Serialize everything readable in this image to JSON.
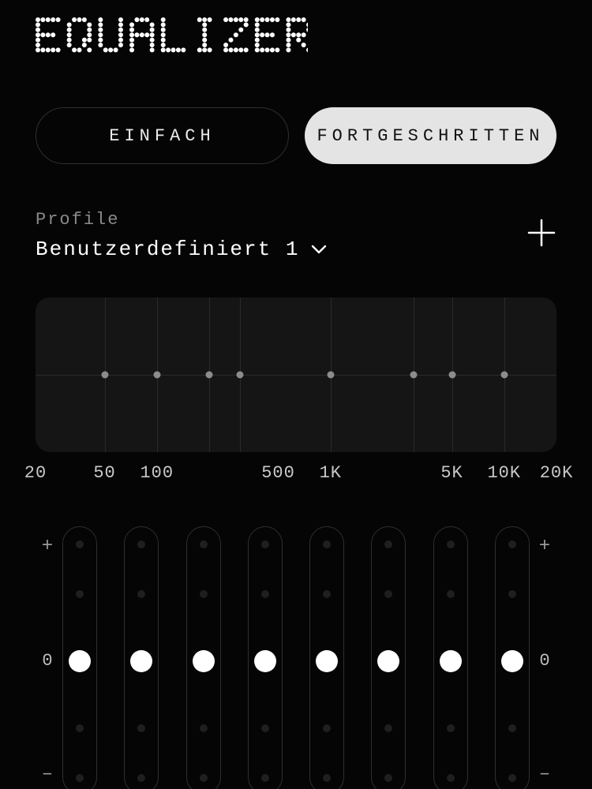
{
  "title": "EQUALIZER",
  "tabs": {
    "simple": "EINFACH",
    "advanced": "FORTGESCHRITTEN",
    "active": "advanced"
  },
  "profile": {
    "label": "Profile",
    "selected": "Benutzerdefiniert 1"
  },
  "side": {
    "plus": "+",
    "zero": "0",
    "minus": "–"
  },
  "chart_data": {
    "type": "line",
    "title": "",
    "xlabel": "",
    "ylabel": "",
    "x_axis_scale": "log",
    "xlim": [
      20,
      20000
    ],
    "ylim": [
      -6,
      6
    ],
    "x_tick_labels": [
      "20",
      "50",
      "100",
      "500",
      "1K",
      "5K",
      "10K",
      "20K"
    ],
    "x_tick_values": [
      20,
      50,
      100,
      500,
      1000,
      5000,
      10000,
      20000
    ],
    "vertical_gridlines_at_x": [
      50,
      100,
      200,
      300,
      1000,
      3000,
      5000,
      10000
    ],
    "bands_hz": [
      50,
      100,
      200,
      300,
      1000,
      3000,
      5000,
      10000
    ],
    "values_db": [
      0,
      0,
      0,
      0,
      0,
      0,
      0,
      0
    ]
  },
  "sliders": {
    "count": 8,
    "range_db": [
      -6,
      6
    ],
    "ticks_db": [
      6,
      3,
      0,
      -3,
      -6
    ],
    "values_db": [
      0,
      0,
      0,
      0,
      0,
      0,
      0,
      0
    ]
  }
}
